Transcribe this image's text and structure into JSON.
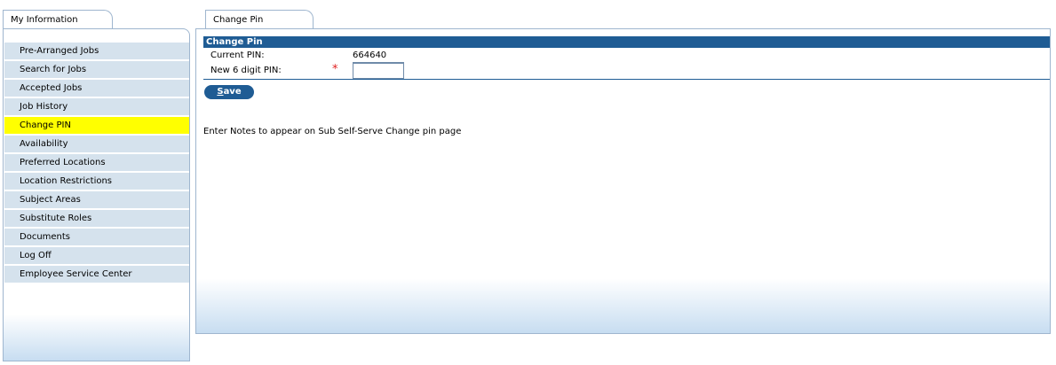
{
  "tabs": {
    "left_label": "My Information",
    "right_label": "Change Pin"
  },
  "sidebar": {
    "items": [
      {
        "label": "Pre-Arranged Jobs",
        "active": false
      },
      {
        "label": "Search for Jobs",
        "active": false
      },
      {
        "label": "Accepted Jobs",
        "active": false
      },
      {
        "label": "Job History",
        "active": false
      },
      {
        "label": "Change PIN",
        "active": true
      },
      {
        "label": "Availability",
        "active": false
      },
      {
        "label": "Preferred Locations",
        "active": false
      },
      {
        "label": "Location Restrictions",
        "active": false
      },
      {
        "label": "Subject Areas",
        "active": false
      },
      {
        "label": "Substitute Roles",
        "active": false
      },
      {
        "label": "Documents",
        "active": false
      },
      {
        "label": "Log Off",
        "active": false
      },
      {
        "label": "Employee Service Center",
        "active": false
      }
    ]
  },
  "form": {
    "header": "Change Pin",
    "current_pin_label": "Current PIN:",
    "current_pin_value": "664640",
    "new_pin_label": "New 6 digit PIN:",
    "required_mark": "*",
    "new_pin_value": "",
    "save_label_first": "S",
    "save_label_rest": "ave",
    "notes": "Enter Notes to appear on Sub Self-Serve Change pin page"
  },
  "colors": {
    "header_bg": "#1f5c94",
    "active_item_bg": "#ffff00",
    "sidebar_item_bg": "#d5e2ed",
    "required": "#e02020"
  }
}
